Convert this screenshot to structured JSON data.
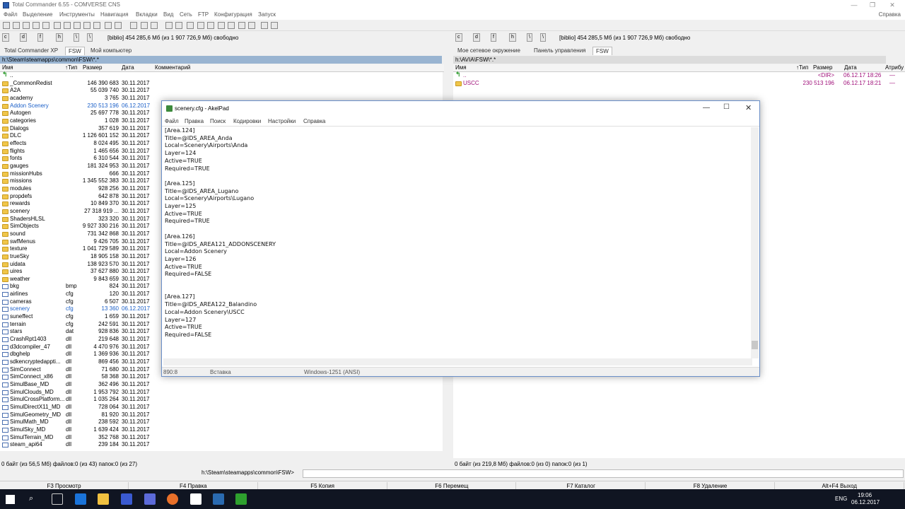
{
  "window": {
    "title": "Total Commander 6.55 - COMVERSE CNS"
  },
  "menu": [
    "Файл",
    "Выделение",
    "Инструменты",
    "Навигация",
    "Вкладки",
    "Вид",
    "Сеть",
    "FTP",
    "Конфигурация",
    "Запуск"
  ],
  "menu_right": "Справка",
  "left": {
    "drives": [
      "c",
      "d",
      "f",
      "h",
      "\\",
      "\\"
    ],
    "drive_info": "[biblio]  454 285,6 Мб  (из 1 907 726,9 Мб) свободно",
    "tabs": [
      "Total Commander XP",
      "FSW",
      "Мой компьютер"
    ],
    "active_tab": 1,
    "path": "h:\\Steam\\steamapps\\common\\FSW\\*.*",
    "columns": {
      "name": "Имя",
      "ext": "↑Тип",
      "size": "Размер",
      "date": "Дата",
      "comment": "Комментарий"
    },
    "rows": [
      {
        "n": "..",
        "e": "",
        "s": "",
        "d": "",
        "t": "up"
      },
      {
        "n": "_CommonRedist",
        "e": "",
        "s": "146 390 683",
        "d": "30.11.2017",
        "t": "folder"
      },
      {
        "n": "A2A",
        "e": "",
        "s": "55 039 740",
        "d": "30.11.2017",
        "t": "folder"
      },
      {
        "n": "academy",
        "e": "",
        "s": "3 765",
        "d": "30.11.2017",
        "t": "folder"
      },
      {
        "n": "Addon Scenery",
        "e": "",
        "s": "230 513 196",
        "d": "06.12.2017",
        "t": "folder",
        "c": "blue"
      },
      {
        "n": "Autogen",
        "e": "",
        "s": "25 697 778",
        "d": "30.11.2017",
        "t": "folder"
      },
      {
        "n": "categories",
        "e": "",
        "s": "1 028",
        "d": "30.11.2017",
        "t": "folder"
      },
      {
        "n": "Dialogs",
        "e": "",
        "s": "357 619",
        "d": "30.11.2017",
        "t": "folder"
      },
      {
        "n": "DLC",
        "e": "",
        "s": "1 126 601 152",
        "d": "30.11.2017",
        "t": "folder"
      },
      {
        "n": "effects",
        "e": "",
        "s": "8 024 495",
        "d": "30.11.2017",
        "t": "folder"
      },
      {
        "n": "flights",
        "e": "",
        "s": "1 465 656",
        "d": "30.11.2017",
        "t": "folder"
      },
      {
        "n": "fonts",
        "e": "",
        "s": "6 310 544",
        "d": "30.11.2017",
        "t": "folder"
      },
      {
        "n": "gauges",
        "e": "",
        "s": "181 324 953",
        "d": "30.11.2017",
        "t": "folder"
      },
      {
        "n": "missionHubs",
        "e": "",
        "s": "666",
        "d": "30.11.2017",
        "t": "folder"
      },
      {
        "n": "missions",
        "e": "",
        "s": "1 345 552 383",
        "d": "30.11.2017",
        "t": "folder"
      },
      {
        "n": "modules",
        "e": "",
        "s": "928 256",
        "d": "30.11.2017",
        "t": "folder"
      },
      {
        "n": "propdefs",
        "e": "",
        "s": "642 878",
        "d": "30.11.2017",
        "t": "folder"
      },
      {
        "n": "rewards",
        "e": "",
        "s": "10 849 370",
        "d": "30.11.2017",
        "t": "folder"
      },
      {
        "n": "scenery",
        "e": "",
        "s": "27 318 919 ...",
        "d": "30.11.2017",
        "t": "folder"
      },
      {
        "n": "ShadersHLSL",
        "e": "",
        "s": "323 320",
        "d": "30.11.2017",
        "t": "folder"
      },
      {
        "n": "SimObjects",
        "e": "",
        "s": "9 927 330 216",
        "d": "30.11.2017",
        "t": "folder"
      },
      {
        "n": "sound",
        "e": "",
        "s": "731 342 868",
        "d": "30.11.2017",
        "t": "folder"
      },
      {
        "n": "swfMenus",
        "e": "",
        "s": "9 426 705",
        "d": "30.11.2017",
        "t": "folder"
      },
      {
        "n": "texture",
        "e": "",
        "s": "1 041 729 589",
        "d": "30.11.2017",
        "t": "folder"
      },
      {
        "n": "trueSky",
        "e": "",
        "s": "18 905 158",
        "d": "30.11.2017",
        "t": "folder"
      },
      {
        "n": "uidata",
        "e": "",
        "s": "138 923 570",
        "d": "30.11.2017",
        "t": "folder"
      },
      {
        "n": "uires",
        "e": "",
        "s": "37 627 880",
        "d": "30.11.2017",
        "t": "folder"
      },
      {
        "n": "weather",
        "e": "",
        "s": "9 843 659",
        "d": "30.11.2017",
        "t": "folder"
      },
      {
        "n": "bkg",
        "e": "bmp",
        "s": "824",
        "d": "30.11.2017",
        "t": "file"
      },
      {
        "n": "airlines",
        "e": "cfg",
        "s": "120",
        "d": "30.11.2017",
        "t": "file"
      },
      {
        "n": "cameras",
        "e": "cfg",
        "s": "6 507",
        "d": "30.11.2017",
        "t": "file"
      },
      {
        "n": "scenery",
        "e": "cfg",
        "s": "13 360",
        "d": "06.12.2017",
        "t": "file",
        "c": "blue"
      },
      {
        "n": "suneffect",
        "e": "cfg",
        "s": "1 659",
        "d": "30.11.2017",
        "t": "file"
      },
      {
        "n": "terrain",
        "e": "cfg",
        "s": "242 591",
        "d": "30.11.2017",
        "t": "file"
      },
      {
        "n": "stars",
        "e": "dat",
        "s": "928 836",
        "d": "30.11.2017",
        "t": "file"
      },
      {
        "n": "CrashRpt1403",
        "e": "dll",
        "s": "219 648",
        "d": "30.11.2017",
        "t": "file"
      },
      {
        "n": "d3dcompiler_47",
        "e": "dll",
        "s": "4 470 976",
        "d": "30.11.2017",
        "t": "file"
      },
      {
        "n": "dbghelp",
        "e": "dll",
        "s": "1 369 936",
        "d": "30.11.2017",
        "t": "file"
      },
      {
        "n": "sdkencryptedappti...",
        "e": "dll",
        "s": "869 456",
        "d": "30.11.2017",
        "t": "file"
      },
      {
        "n": "SimConnect",
        "e": "dll",
        "s": "71 680",
        "d": "30.11.2017",
        "t": "file"
      },
      {
        "n": "SimConnect_x86",
        "e": "dll",
        "s": "58 368",
        "d": "30.11.2017",
        "t": "file"
      },
      {
        "n": "SimulBase_MD",
        "e": "dll",
        "s": "362 496",
        "d": "30.11.2017",
        "t": "file"
      },
      {
        "n": "SimulClouds_MD",
        "e": "dll",
        "s": "1 953 792",
        "d": "30.11.2017",
        "t": "file"
      },
      {
        "n": "SimulCrossPlatform...",
        "e": "dll",
        "s": "1 035 264",
        "d": "30.11.2017",
        "t": "file"
      },
      {
        "n": "SimulDirectX11_MD",
        "e": "dll",
        "s": "728 064",
        "d": "30.11.2017",
        "t": "file"
      },
      {
        "n": "SimulGeometry_MD",
        "e": "dll",
        "s": "81 920",
        "d": "30.11.2017",
        "t": "file"
      },
      {
        "n": "SimulMath_MD",
        "e": "dll",
        "s": "238 592",
        "d": "30.11.2017",
        "t": "file"
      },
      {
        "n": "SimulSky_MD",
        "e": "dll",
        "s": "1 639 424",
        "d": "30.11.2017",
        "t": "file"
      },
      {
        "n": "SimulTerrain_MD",
        "e": "dll",
        "s": "352 768",
        "d": "30.11.2017",
        "t": "file"
      },
      {
        "n": "steam_api64",
        "e": "dll",
        "s": "239 184",
        "d": "30.11.2017",
        "t": "file"
      }
    ],
    "status": "0 байт (из 56,5 Мб) файлов:0 (из 43) папок:0 (из 27)"
  },
  "right": {
    "drives": [
      "c",
      "d",
      "f",
      "h",
      "\\",
      "\\"
    ],
    "drive_info": "[biblio]  454 285,5 Мб  (из 1 907 726,9 Мб) свободно",
    "tabs": [
      "Мое сетевое окружение",
      "Панель управления",
      "FSW"
    ],
    "active_tab": 2,
    "path": "h:\\AVIA\\FSW\\*.*",
    "columns": {
      "name": "Имя",
      "ext": "↑Тип",
      "size": "Размер",
      "date": "Дата",
      "attr": "Атрибу"
    },
    "rows": [
      {
        "n": "..",
        "s": "<DIR>",
        "d": "06.12.17 18:26",
        "a": "—",
        "t": "up"
      },
      {
        "n": "USCC",
        "s": "230 513 196",
        "d": "06.12.17 18:21",
        "a": "—",
        "t": "folder"
      }
    ],
    "status": "0 байт (из 219,8 Мб) файлов:0 (из 0) папок:0 (из 1)"
  },
  "cmdline": {
    "prompt": "h:\\Steam\\steamapps\\common\\FSW>"
  },
  "fkeys": [
    "F3 Просмотр",
    "F4 Правка",
    "F5 Копия",
    "F6 Перемещ",
    "F7 Каталог",
    "F8 Удаление",
    "Alt+F4 Выход"
  ],
  "akelpad": {
    "title": "scenery.cfg - AkelPad",
    "menu": [
      "Файл",
      "Правка",
      "Поиск",
      "Кодировки",
      "Настройки",
      "Справка"
    ],
    "lines": [
      "[Area.124]",
      "Title=@IDS_AREA_Anda",
      "Local=Scenery\\Airports\\Anda",
      "Layer=124",
      "Active=TRUE",
      "Required=TRUE",
      "",
      "[Area.125]",
      "Title=@IDS_AREA_Lugano",
      "Local=Scenery\\Airports\\Lugano",
      "Layer=125",
      "Active=TRUE",
      "Required=TRUE",
      "",
      "[Area.126]",
      "Title=@IDS_AREA121_ADDONSCENERY",
      "Local=Addon Scenery",
      "Layer=126",
      "Active=TRUE",
      "Required=FALSE",
      "",
      "",
      "[Area.127]",
      "Title=@IDS_AREA122_Balandino",
      "Local=Addon Scenery\\USCC",
      "Layer=127",
      "Active=TRUE",
      "Required=FALSE"
    ],
    "status": {
      "pos": "890:8",
      "mode": "Вставка",
      "encoding": "Windows-1251 (ANSI)"
    }
  },
  "tray": {
    "lang": "ENG",
    "time": "19:06",
    "date": "06.12.2017"
  },
  "colors": {
    "path_active": "#99b4d1",
    "highlight": "#1a5fc8",
    "taskbar": "#101522"
  }
}
